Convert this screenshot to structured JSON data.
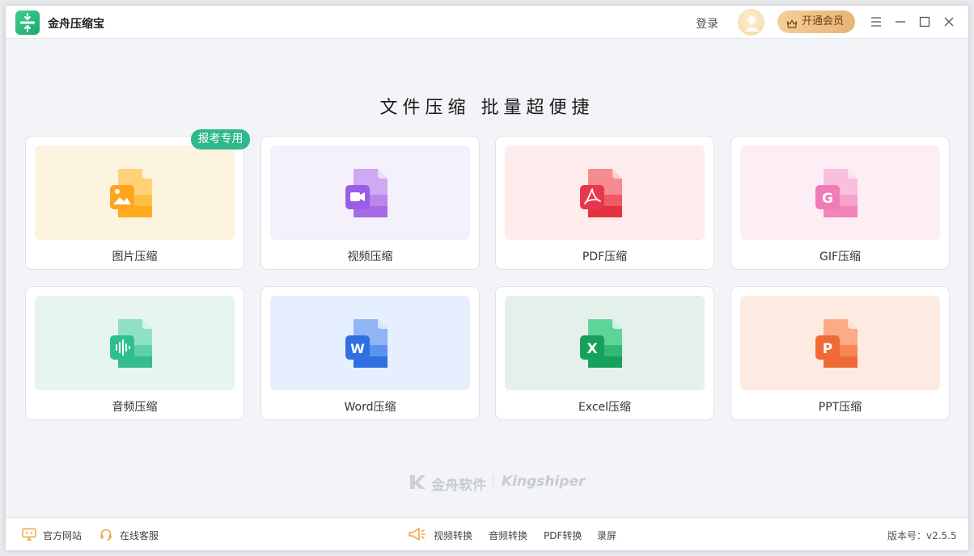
{
  "app": {
    "title": "金舟压缩宝"
  },
  "header": {
    "login_label": "登录",
    "vip_label": "开通会员"
  },
  "heading": "文件压缩  批量超便捷",
  "badge": "报考专用",
  "cards": [
    {
      "label": "图片压缩",
      "icon": "image-file-icon",
      "bg": "#fdf4e0",
      "color": "#f9a826"
    },
    {
      "label": "视频压缩",
      "icon": "video-file-icon",
      "bg": "#f4f1fc",
      "color": "#9b5de5"
    },
    {
      "label": "PDF压缩",
      "icon": "pdf-file-icon",
      "bg": "#fdeceb",
      "color": "#e8374a"
    },
    {
      "label": "GIF压缩",
      "icon": "gif-file-icon",
      "bg": "#fdeef6",
      "color": "#f07bb8"
    },
    {
      "label": "音频压缩",
      "icon": "audio-file-icon",
      "bg": "#e6f5ef",
      "color": "#2fbf8e"
    },
    {
      "label": "Word压缩",
      "icon": "word-file-icon",
      "bg": "#e6effd",
      "color": "#2f6fe0"
    },
    {
      "label": "Excel压缩",
      "icon": "excel-file-icon",
      "bg": "#e3f1ea",
      "color": "#17a05b"
    },
    {
      "label": "PPT压缩",
      "icon": "ppt-file-icon",
      "bg": "#fdebe2",
      "color": "#f06a35"
    }
  ],
  "brand": {
    "cn": "金舟软件",
    "en": "Kingshiper"
  },
  "footer": {
    "website_label": "官方网站",
    "support_label": "在线客服",
    "links": [
      "视频转换",
      "音频转换",
      "PDF转换",
      "录屏"
    ],
    "version": "版本号：v2.5.5"
  }
}
